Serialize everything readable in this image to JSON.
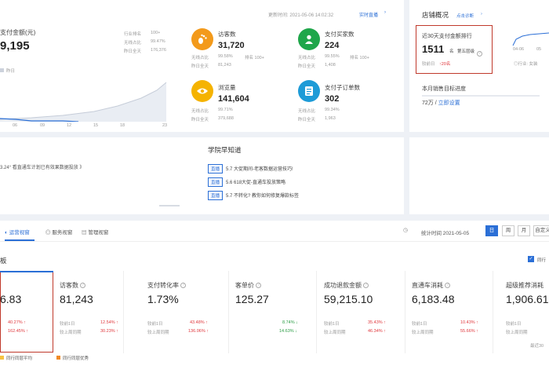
{
  "top": {
    "updated_label": "更新时间: 2021-05-06 14:02:32",
    "live_link": "实时直播",
    "pay_amount_title": "支付金额(元)",
    "pay_amount_value": "9,195",
    "rank_label": "行业排名",
    "rank_value": "100+",
    "wireless_label": "无线占比",
    "wireless_value": "99.47%",
    "yesterday_label": "昨日全天",
    "yesterday_value": "176,376",
    "legend_yesterday": "昨日",
    "chart_ticks": [
      "06",
      "09",
      "12",
      "15",
      "18",
      "23"
    ]
  },
  "metrics": [
    {
      "name": "访客数",
      "value": "31,720",
      "r1l": "无线占比",
      "r1v": "99.58%",
      "r1e": "排名  100+",
      "r2l": "昨日全天",
      "r2v": "81,243"
    },
    {
      "name": "支付买家数",
      "value": "224",
      "r1l": "无线占比",
      "r1v": "99.55%",
      "r1e": "排名  100+",
      "r2l": "昨日全天",
      "r2v": "1,408"
    },
    {
      "name": "浏览量",
      "value": "141,604",
      "r1l": "无线占比",
      "r1v": "99.71%",
      "r1e": "",
      "r2l": "昨日全天",
      "r2v": "379,688"
    },
    {
      "name": "支付子订单数",
      "value": "302",
      "r1l": "无线占比",
      "r1v": "99.34%",
      "r1e": "",
      "r2l": "昨日全天",
      "r2v": "1,963"
    }
  ],
  "store": {
    "title": "店铺概况",
    "diag_link": "点击诊断",
    "rank_title": "近30天支付金额排行",
    "rank_value": "1511",
    "rank_unit": "名",
    "rank_tier": "第五层级",
    "compare_label": "较前日",
    "compare_value": "↑20名",
    "side_dates": [
      "04-06",
      "05"
    ],
    "side_note": "◎行业: 女装",
    "target_title": "本月销售目标进度",
    "target_value": "72万 / ",
    "target_link": "立即设置"
  },
  "middle": {
    "left_text": "3.24° 看直通车计划已有效果数据投放 》",
    "school_title": "学院早知道",
    "news": [
      {
        "tag": "直播",
        "text": "5.7 大促期间-老客数据运营技巧!"
      },
      {
        "tag": "直播",
        "text": "5.6 618大促-直通车投放策略"
      },
      {
        "tag": "直播",
        "text": "5.7 不转化? 教你如何修复爆款标签"
      }
    ]
  },
  "tabs": {
    "items": [
      "运营视窗",
      "服务视窗",
      "管理视窗"
    ],
    "stat_time": "统计时间 2021-05-05",
    "periods": [
      "日",
      "周",
      "月"
    ],
    "custom": "自定义"
  },
  "board": {
    "title": "板",
    "peer_label": "同行",
    "kpis": [
      {
        "name": "",
        "value": "6.83",
        "c1": "40.27%",
        "c2": "162.45%"
      },
      {
        "name": "访客数",
        "value": "81,243",
        "c1": "12.54%",
        "c2": "30.23%"
      },
      {
        "name": "支付转化率",
        "value": "1.73%",
        "c1": "43.48%",
        "c2": "136.06%"
      },
      {
        "name": "客单价",
        "value": "125.27",
        "c1": "8.74%",
        "c2": "14.63%"
      },
      {
        "name": "成功退款金额",
        "value": "59,215.10",
        "c1": "35.43%",
        "c2": "46.34%"
      },
      {
        "name": "直通车消耗",
        "value": "6,183.48",
        "c1": "10.43%",
        "c2": "55.66%"
      },
      {
        "name": "超级推荐消耗",
        "value": "1,906.61",
        "c1": "",
        "c2": ""
      }
    ],
    "cmp_day": "较前1日",
    "cmp_week": "较上周同期",
    "footer_right": "最近30",
    "legend_avg": "同行同层平均",
    "legend_best": "同行同层优秀"
  },
  "colors": {
    "accent": "#2b6fd6",
    "up": "#e0393e",
    "down": "#2c9d46",
    "highlight": "#c0392b"
  }
}
